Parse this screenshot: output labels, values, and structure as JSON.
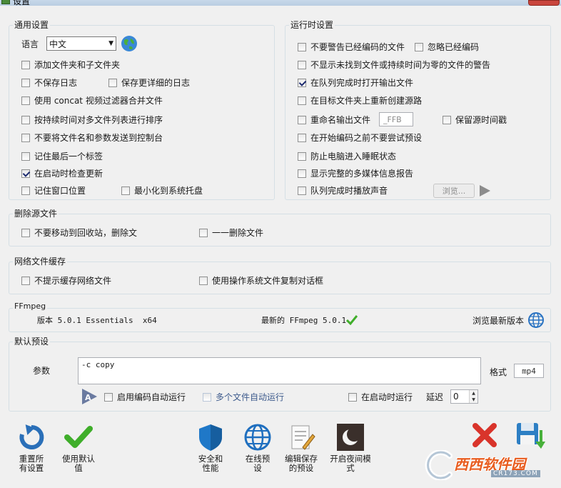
{
  "window": {
    "title": "设置"
  },
  "general": {
    "title": "通用设置",
    "language_label": "语言",
    "language_value": "中文",
    "options": {
      "add_subfolders": {
        "label": "添加文件夹和子文件夹",
        "checked": false
      },
      "no_log": {
        "label": "不保存日志",
        "checked": false
      },
      "verbose_log": {
        "label": "保存更详细的日志",
        "checked": false
      },
      "concat": {
        "label": "使用 concat 视频过滤器合并文件",
        "checked": false
      },
      "sort_duration": {
        "label": "按持续时间对多文件列表进行排序",
        "checked": false
      },
      "no_console": {
        "label": "不要将文件名和参数发送到控制台",
        "checked": false
      },
      "remember_tab": {
        "label": "记住最后一个标签",
        "checked": false
      },
      "check_updates": {
        "label": "在启动时检查更新",
        "checked": true
      },
      "remember_pos": {
        "label": "记住窗口位置",
        "checked": false
      },
      "minimize_tray": {
        "label": "最小化到系统托盘",
        "checked": false
      }
    }
  },
  "runtime": {
    "title": "运行时设置",
    "options": {
      "no_warn_encoded": {
        "label": "不要警告已经编码的文件",
        "checked": false
      },
      "ignore_encoded": {
        "label": "忽略已经编码",
        "checked": false
      },
      "no_warn_missing": {
        "label": "不显示未找到文件或持续时间为零的文件的警告",
        "checked": false
      },
      "open_output": {
        "label": "在队列完成时打开输出文件",
        "checked": true
      },
      "recreate_source": {
        "label": "在目标文件夹上重新创建源路",
        "checked": false
      },
      "rename_output": {
        "label": "重命名输出文件",
        "checked": false
      },
      "keep_timestamp": {
        "label": "保留源时间戳",
        "checked": false
      },
      "no_try_preset": {
        "label": "在开始编码之前不要尝试预设",
        "checked": false
      },
      "prevent_sleep": {
        "label": "防止电脑进入睡眠状态",
        "checked": false
      },
      "full_media_info": {
        "label": "显示完整的多媒体信息报告",
        "checked": false
      },
      "play_sound": {
        "label": "队列完成时播放声音",
        "checked": false
      }
    },
    "rename_placeholder": "_FFB",
    "browse_label": "浏览..."
  },
  "delete_source": {
    "title": "删除源文件",
    "options": {
      "no_recycle": {
        "label": "不要移动到回收站，删除文",
        "checked": false
      },
      "one_by_one": {
        "label": "一一删除文件",
        "checked": false
      }
    }
  },
  "network_cache": {
    "title": "网络文件缓存",
    "options": {
      "no_prompt": {
        "label": "不提示缓存网络文件",
        "checked": false
      },
      "os_copy": {
        "label": "使用操作系统文件复制对话框",
        "checked": false
      }
    }
  },
  "ffmpeg": {
    "title": "FFmpeg",
    "version": "版本 5.0.1 Essentials  x64",
    "latest": "最新的 FFmpeg 5.0.1",
    "browse_latest": "浏览最新版本"
  },
  "default_preset": {
    "title": "默认预设",
    "params_label": "参数",
    "params_value": "-c copy",
    "format_label": "格式",
    "format_value": "mp4",
    "options": {
      "auto_run_encode": {
        "label": "启用编码自动运行",
        "checked": false
      },
      "multi_auto_run": {
        "label": "多个文件自动运行",
        "checked": false
      },
      "run_on_start": {
        "label": "在启动时运行",
        "checked": false
      }
    },
    "delay_label": "延迟",
    "delay_value": "0"
  },
  "toolbar": {
    "reset": "重置所\n有设置",
    "use_default": "使用默认\n值",
    "security": "安全和\n性能",
    "online_preset": "在线预\n设",
    "edit_preset": "编辑保存\n的预设",
    "night_mode": "开启夜间模\n式"
  },
  "watermark": {
    "brand": "西西软件园",
    "site": "CR173.COM"
  },
  "colors": {
    "reset_blue": "#2a6fb8",
    "check_green": "#3fae2a",
    "shield_blue": "#1f78c8",
    "close_red": "#d9342b",
    "save_blue": "#2d7fc4",
    "save_green": "#48b03a"
  }
}
